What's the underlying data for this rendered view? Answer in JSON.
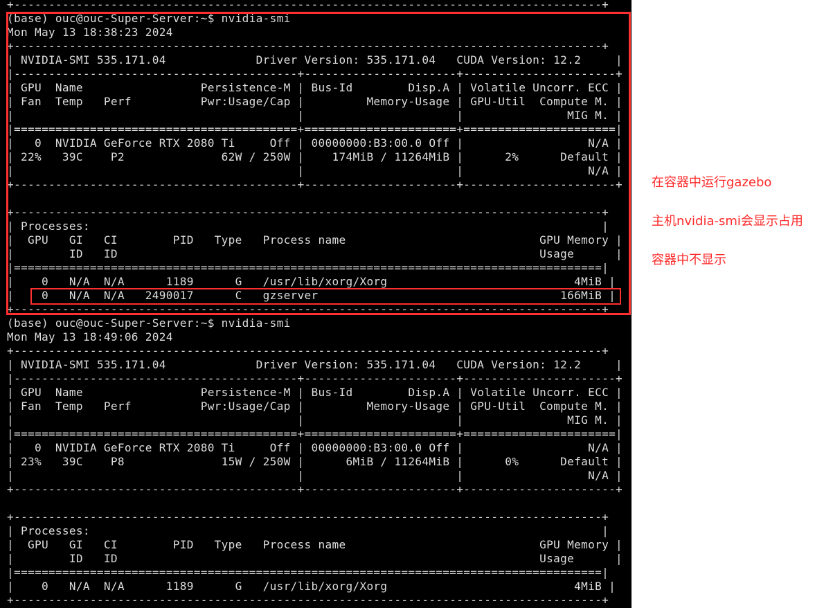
{
  "terminal": {
    "lines": [
      "+-------------------------------------------------------------------------------------+",
      "(base) ouc@ouc-Super-Server:~$ nvidia-smi",
      "Mon May 13 18:38:23 2024",
      "+-------------------------------------------------------------------------------------+",
      "| NVIDIA-SMI 535.171.04             Driver Version: 535.171.04   CUDA Version: 12.2     |",
      "|-----------------------------------------+----------------------+----------------------+",
      "| GPU  Name                 Persistence-M | Bus-Id        Disp.A | Volatile Uncorr. ECC |",
      "| Fan  Temp   Perf          Pwr:Usage/Cap |         Memory-Usage | GPU-Util  Compute M. |",
      "|                                         |                      |               MIG M. |",
      "|=========================================+======================+======================|",
      "|   0  NVIDIA GeForce RTX 2080 Ti     Off | 00000000:B3:00.0 Off |                  N/A |",
      "| 22%   39C    P2              62W / 250W |    174MiB / 11264MiB |      2%      Default |",
      "|                                         |                      |                  N/A |",
      "+-----------------------------------------+----------------------+----------------------+",
      "",
      "+-------------------------------------------------------------------------------------+",
      "| Processes:                                                                          |",
      "|  GPU   GI   CI        PID   Type   Process name                            GPU Memory |",
      "|        ID   ID                                                             Usage      |",
      "|=====================================================================================|",
      "|    0   N/A  N/A      1189      G   /usr/lib/xorg/Xorg                           4MiB |",
      "|    0   N/A  N/A   2490017      C   gzserver                                   166MiB |",
      "+-------------------------------------------------------------------------------------+",
      "(base) ouc@ouc-Super-Server:~$ nvidia-smi",
      "Mon May 13 18:49:06 2024",
      "+-------------------------------------------------------------------------------------+",
      "| NVIDIA-SMI 535.171.04             Driver Version: 535.171.04   CUDA Version: 12.2     |",
      "|-----------------------------------------+----------------------+----------------------+",
      "| GPU  Name                 Persistence-M | Bus-Id        Disp.A | Volatile Uncorr. ECC |",
      "| Fan  Temp   Perf          Pwr:Usage/Cap |         Memory-Usage | GPU-Util  Compute M. |",
      "|                                         |                      |               MIG M. |",
      "|=========================================+======================+======================|",
      "|   0  NVIDIA GeForce RTX 2080 Ti     Off | 00000000:B3:00.0 Off |                  N/A |",
      "| 23%   39C    P8              15W / 250W |      6MiB / 11264MiB |      0%      Default |",
      "|                                         |                      |                  N/A |",
      "+-----------------------------------------+----------------------+----------------------+",
      "",
      "+-------------------------------------------------------------------------------------+",
      "| Processes:                                                                          |",
      "|  GPU   GI   CI        PID   Type   Process name                            GPU Memory |",
      "|        ID   ID                                                             Usage      |",
      "|=====================================================================================|",
      "|    0   N/A  N/A      1189      G   /usr/lib/xorg/Xorg                           4MiB |",
      "+-------------------------------------------------------------------------------------+"
    ]
  },
  "annotations": {
    "line1": "在容器中运行gazebo",
    "line2": "主机nvidia-smi会显示占用",
    "line3": "容器中不显示"
  },
  "colors": {
    "highlight": "#ff3030",
    "terminal_bg": "#000000",
    "terminal_fg": "#dcdcdc",
    "note_text": "#ff2a2a"
  }
}
